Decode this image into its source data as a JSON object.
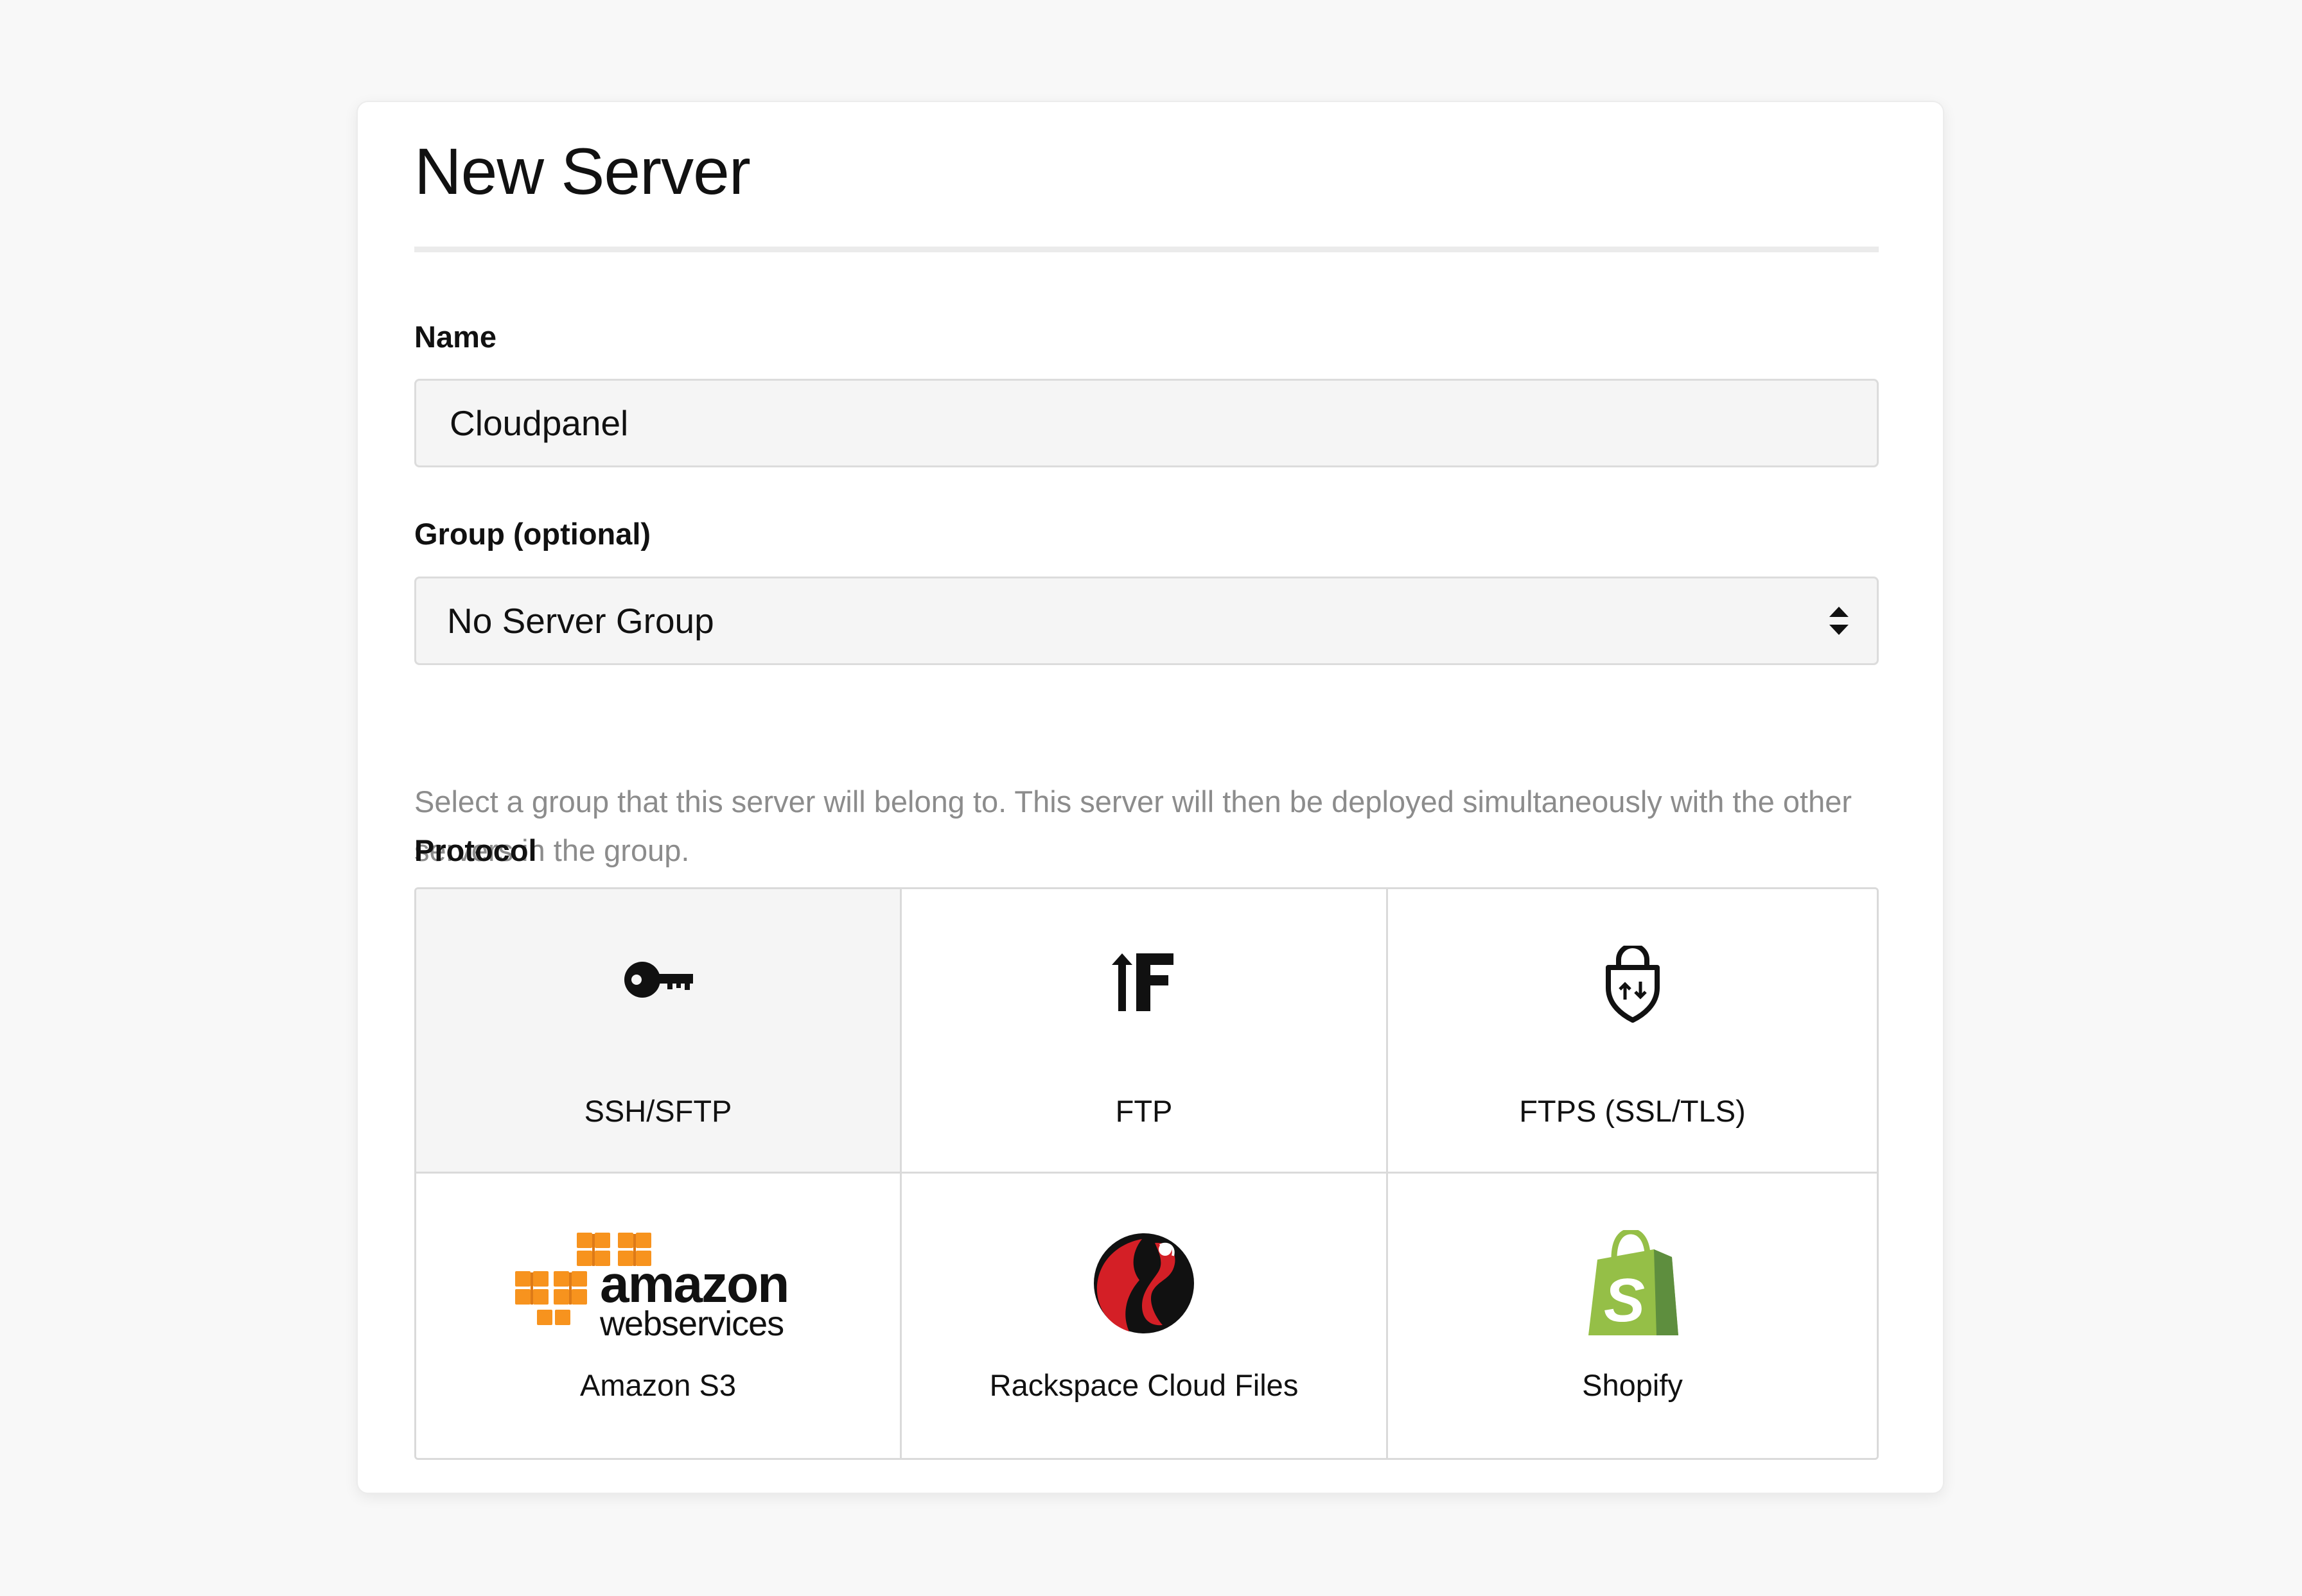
{
  "dialog": {
    "title": "New Server"
  },
  "name_field": {
    "label": "Name",
    "value": "Cloudpanel"
  },
  "group_field": {
    "label": "Group (optional)",
    "selected": "No Server Group",
    "help_text": "Select a group that this server will belong to. This server will then be deployed simultaneously with the other servers in the group."
  },
  "protocol": {
    "label": "Protocol",
    "selected": "SSH/SFTP",
    "options": [
      {
        "label": "SSH/SFTP",
        "icon": "key-icon"
      },
      {
        "label": "FTP",
        "icon": "ftp-upload-icon"
      },
      {
        "label": "FTPS (SSL/TLS)",
        "icon": "shield-lock-icon"
      },
      {
        "label": "Amazon S3",
        "icon": "amazon-web-services-logo",
        "logo_text": "amazon web services"
      },
      {
        "label": "Rackspace Cloud Files",
        "icon": "rackspace-logo"
      },
      {
        "label": "Shopify",
        "icon": "shopify-bag-logo"
      }
    ]
  },
  "colors": {
    "aws_orange": "#f7931e",
    "rackspace_red": "#d41f26",
    "shopify_green": "#95bf47",
    "shopify_dark": "#5e8e3e",
    "help_gray": "#8c8c8c",
    "selected_bg": "#f5f5f5"
  }
}
